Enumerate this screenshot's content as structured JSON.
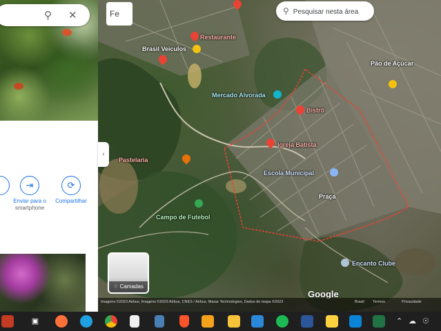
{
  "panel": {
    "search_icon": "search-icon",
    "close_icon": "close-icon",
    "actions": [
      {
        "icon": "send-to-phone-icon",
        "label": "Enviar para o",
        "label2": "smartphone"
      },
      {
        "icon": "share-icon",
        "label": "Compartilhar",
        "label2": ""
      }
    ],
    "left_partial_label": "o"
  },
  "map": {
    "filter_label": "Fe",
    "search_area_label": "Pesquisar nesta área",
    "layer_label": "Camadas",
    "google_logo": "Google",
    "attribution": "Imagens ©2023 Airbus, Imagens ©2023 Airbus, CNES / Airbus, Maxar Technologies, Dados do mapa ©2023",
    "attribution_right1": "Brasil",
    "attribution_right2": "Termos",
    "attribution_right3": "Privacidade",
    "labels": [
      {
        "text": "Restaurante",
        "color": "red"
      },
      {
        "text": "Brasil Veiculos",
        "color": "yellow"
      },
      {
        "text": "Mercado Alvorada",
        "color": "teal"
      },
      {
        "text": "Bistrô",
        "color": "red"
      },
      {
        "text": "Igreja Batista",
        "color": "red"
      },
      {
        "text": "Pastelaria",
        "color": "red"
      },
      {
        "text": "Escola Municipal",
        "color": "blue"
      },
      {
        "text": "Praça",
        "color": "white"
      },
      {
        "text": "Campo de Futebol",
        "color": "green"
      },
      {
        "text": "Encanto Clube",
        "color": "blue"
      },
      {
        "text": "Pão de Açúcar",
        "color": "white"
      }
    ],
    "colors": {
      "boundary": "#ea4335",
      "pin_red": "#ea4335",
      "pin_yellow": "#f4c20d",
      "pin_teal": "#12b5cb",
      "pin_green": "#34a853"
    }
  },
  "taskbar": {
    "apps": [
      "start-icon",
      "task-view-icon",
      "firefox-icon",
      "edge-icon",
      "chrome-icon",
      "notepad-icon",
      "calculator-icon",
      "brave-icon",
      "paint-icon",
      "file-explorer-icon",
      "mail-icon",
      "spotify-icon",
      "word-icon",
      "sticky-notes-icon",
      "photos-icon",
      "excel-icon"
    ],
    "tray": [
      "chevron-up-icon",
      "cloud-icon",
      "volume-icon"
    ]
  }
}
